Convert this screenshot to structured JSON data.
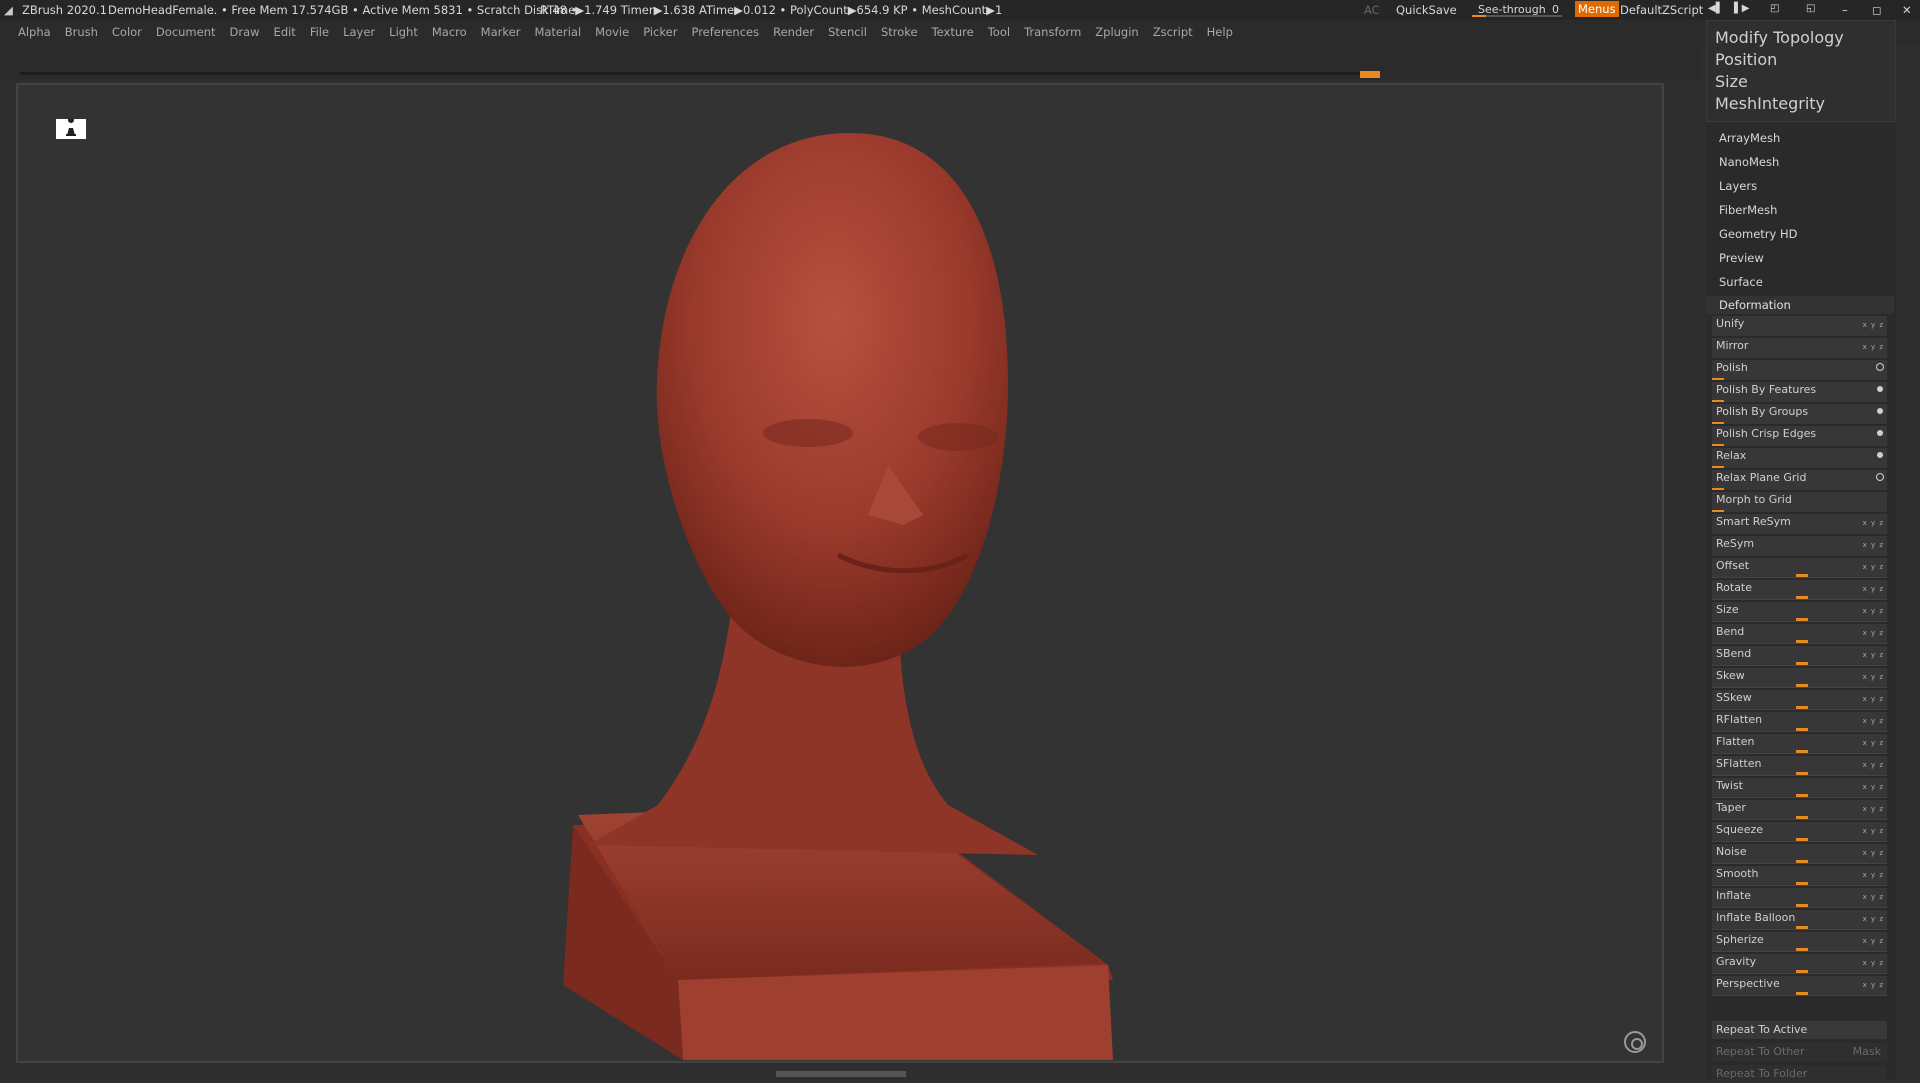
{
  "titlebar": {
    "app": "ZBrush 2020.1",
    "doc": "DemoHeadFemale",
    "status": ".. • Free Mem 17.574GB • Active Mem 5831 • Scratch Disk 48 •",
    "timers": "RTime▶1.749 Timer▶1.638 ATime▶0.012 • PolyCount▶654.9 KP • MeshCount▶1",
    "ac": "AC",
    "quicksave": "QuickSave",
    "see_through": "See-through",
    "see_through_value": "0",
    "menus": "Menus",
    "script": "DefaultZScript"
  },
  "menubar": [
    "Alpha",
    "Brush",
    "Color",
    "Document",
    "Draw",
    "Edit",
    "File",
    "Layer",
    "Light",
    "Macro",
    "Marker",
    "Material",
    "Movie",
    "Picker",
    "Preferences",
    "Render",
    "Stencil",
    "Stroke",
    "Texture",
    "Tool",
    "Transform",
    "Zplugin",
    "Zscript",
    "Help"
  ],
  "subpanel": [
    "Modify Topology",
    "Position",
    "Size",
    "MeshIntegrity"
  ],
  "sections": [
    "ArrayMesh",
    "NanoMesh",
    "Layers",
    "FiberMesh",
    "Geometry HD",
    "Preview",
    "Surface"
  ],
  "deformation": {
    "title": "Deformation",
    "rows": [
      {
        "label": "Unify",
        "kind": "xyz"
      },
      {
        "label": "Mirror",
        "kind": "xyz"
      },
      {
        "label": "Polish",
        "kind": "ring"
      },
      {
        "label": "Polish By Features",
        "kind": "dot"
      },
      {
        "label": "Polish By Groups",
        "kind": "dot"
      },
      {
        "label": "Polish Crisp Edges",
        "kind": "dot"
      },
      {
        "label": "Relax",
        "kind": "dot"
      },
      {
        "label": "Relax Plane Grid",
        "kind": "ring"
      },
      {
        "label": "Morph to Grid",
        "kind": "none"
      },
      {
        "label": "Smart ReSym",
        "kind": "xyz"
      },
      {
        "label": "ReSym",
        "kind": "xyz"
      },
      {
        "label": "Offset",
        "kind": "slider"
      },
      {
        "label": "Rotate",
        "kind": "slider"
      },
      {
        "label": "Size",
        "kind": "slider"
      },
      {
        "label": "Bend",
        "kind": "slider"
      },
      {
        "label": "SBend",
        "kind": "slider"
      },
      {
        "label": "Skew",
        "kind": "slider"
      },
      {
        "label": "SSkew",
        "kind": "slider"
      },
      {
        "label": "RFlatten",
        "kind": "slider"
      },
      {
        "label": "Flatten",
        "kind": "slider"
      },
      {
        "label": "SFlatten",
        "kind": "slider"
      },
      {
        "label": "Twist",
        "kind": "slider"
      },
      {
        "label": "Taper",
        "kind": "slider"
      },
      {
        "label": "Squeeze",
        "kind": "slider"
      },
      {
        "label": "Noise",
        "kind": "slider"
      },
      {
        "label": "Smooth",
        "kind": "slider"
      },
      {
        "label": "Inflate",
        "kind": "slider"
      },
      {
        "label": "Inflate Balloon",
        "kind": "slider"
      },
      {
        "label": "Spherize",
        "kind": "slider"
      },
      {
        "label": "Gravity",
        "kind": "slider"
      },
      {
        "label": "Perspective",
        "kind": "slider"
      }
    ],
    "repeat_active": "Repeat To Active",
    "repeat_other": "Repeat To Other",
    "mask": "Mask",
    "repeat_folder": "Repeat To Folder"
  },
  "colors": {
    "accent": "#e88a20",
    "mesh": "#9a3a2c"
  }
}
